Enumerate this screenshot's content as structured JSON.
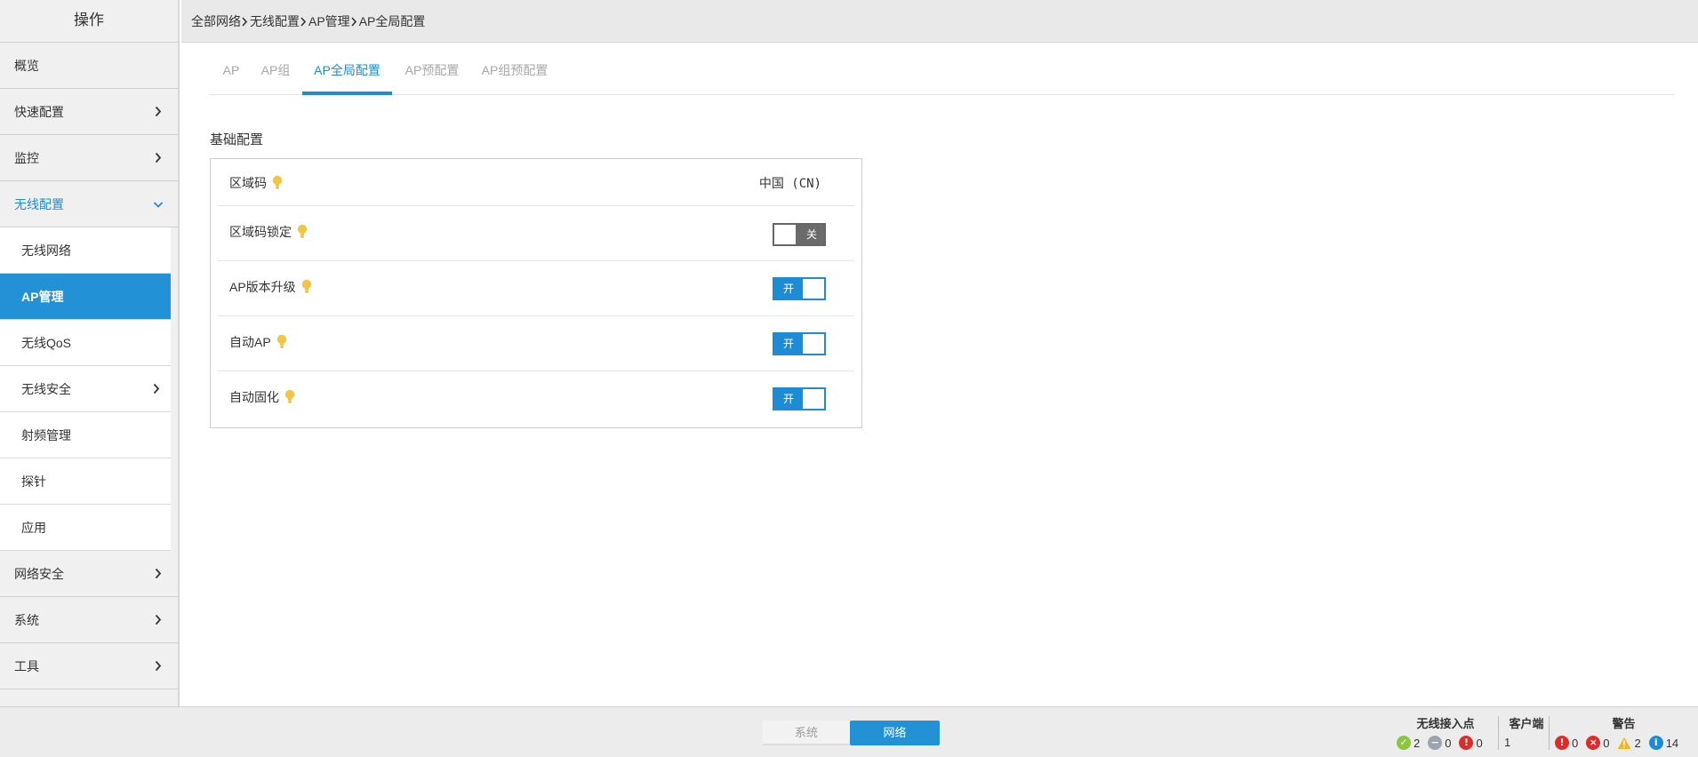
{
  "sidebar": {
    "title": "操作",
    "items": [
      {
        "label": "概览"
      },
      {
        "label": "快速配置"
      },
      {
        "label": "监控"
      },
      {
        "label": "无线配置"
      }
    ],
    "submenu": [
      {
        "label": "无线网络"
      },
      {
        "label": "AP管理"
      },
      {
        "label": "无线QoS"
      },
      {
        "label": "无线安全"
      },
      {
        "label": "射频管理"
      },
      {
        "label": "探针"
      },
      {
        "label": "应用"
      }
    ],
    "bottom_items": [
      {
        "label": "网络安全"
      },
      {
        "label": "系统"
      },
      {
        "label": "工具"
      }
    ]
  },
  "breadcrumb": [
    "全部网络",
    "无线配置",
    "AP管理",
    "AP全局配置"
  ],
  "tabs": [
    {
      "label": "AP"
    },
    {
      "label": "AP组"
    },
    {
      "label": "AP全局配置"
    },
    {
      "label": "AP预配置"
    },
    {
      "label": "AP组预配置"
    }
  ],
  "section": {
    "title": "基础配置",
    "rows": [
      {
        "label": "区域码",
        "value": "中国 (CN)"
      },
      {
        "label": "区域码锁定",
        "toggle": "关",
        "on": false
      },
      {
        "label": "AP版本升级",
        "toggle": "开",
        "on": true
      },
      {
        "label": "自动AP",
        "toggle": "开",
        "on": true
      },
      {
        "label": "自动固化",
        "toggle": "开",
        "on": true
      }
    ]
  },
  "footer": {
    "segments": {
      "system": "系统",
      "network": "网络"
    },
    "wireless_ap": {
      "title": "无线接入点",
      "ok": "2",
      "offline": "0",
      "error": "0"
    },
    "clients": {
      "title": "客户端",
      "count": "1"
    },
    "alerts": {
      "title": "警告",
      "critical": "0",
      "major": "0",
      "warning": "2",
      "info": "14"
    }
  },
  "colors": {
    "accent": "#2391d6",
    "ok": "#8cc63f",
    "offline": "#9aa4ad",
    "error": "#e02b2b",
    "warning": "#f3b61f",
    "info": "#1e8cd4"
  }
}
